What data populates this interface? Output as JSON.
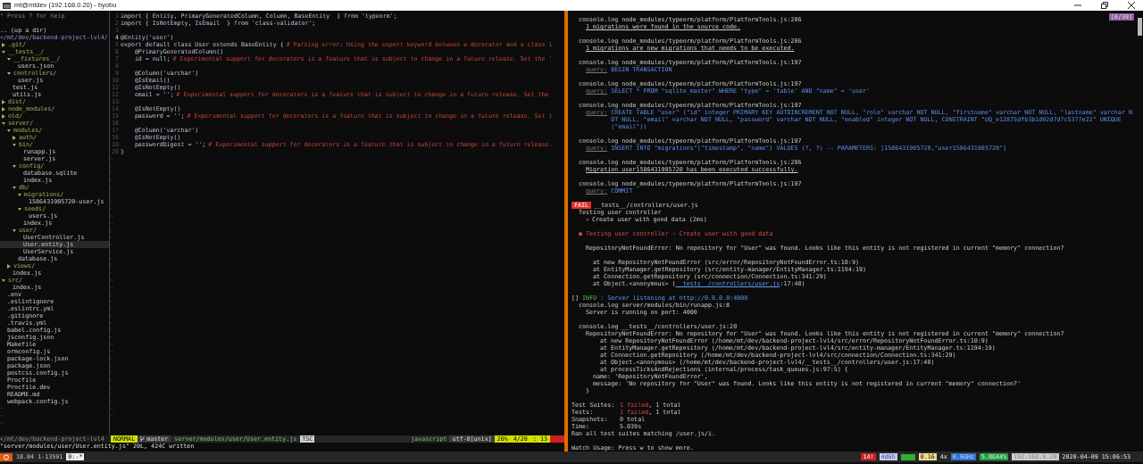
{
  "window": {
    "title": "mt@mtdev (192.168.0.20) - byobu"
  },
  "tree": {
    "help": "\" Press ? for help",
    "up": ".. (up a dir)",
    "root": "</mt/dev/backend-project-lvl4/",
    "filler": "~",
    "items": [
      {
        "name": ".git/",
        "kind": "dir",
        "expanded": false,
        "selected": false
      },
      {
        "name": "__tests__/",
        "kind": "dir",
        "expanded": true,
        "selected": false,
        "children": [
          {
            "name": "__fixtures__/",
            "kind": "dir",
            "expanded": true,
            "selected": false,
            "children": [
              {
                "name": "users.json",
                "kind": "file",
                "selected": false
              }
            ]
          },
          {
            "name": "controllers/",
            "kind": "dir",
            "expanded": true,
            "selected": false,
            "children": [
              {
                "name": "user.js",
                "kind": "file",
                "selected": false
              }
            ]
          },
          {
            "name": "test.js",
            "kind": "file",
            "selected": false
          },
          {
            "name": "utils.js",
            "kind": "file",
            "selected": false
          }
        ]
      },
      {
        "name": "dist/",
        "kind": "dir",
        "expanded": false,
        "selected": false
      },
      {
        "name": "node_modules/",
        "kind": "dir",
        "expanded": false,
        "selected": false
      },
      {
        "name": "old/",
        "kind": "dir",
        "expanded": false,
        "selected": false
      },
      {
        "name": "server/",
        "kind": "dir",
        "expanded": true,
        "selected": false,
        "children": [
          {
            "name": "modules/",
            "kind": "dir",
            "expanded": true,
            "selected": false,
            "children": [
              {
                "name": "auth/",
                "kind": "dir",
                "expanded": false,
                "selected": false
              },
              {
                "name": "bin/",
                "kind": "dir",
                "expanded": true,
                "selected": false,
                "children": [
                  {
                    "name": "runapp.js",
                    "kind": "file",
                    "selected": false
                  },
                  {
                    "name": "server.js",
                    "kind": "file",
                    "selected": false
                  }
                ]
              },
              {
                "name": "config/",
                "kind": "dir",
                "expanded": true,
                "selected": false,
                "children": [
                  {
                    "name": "database.sqlite",
                    "kind": "file",
                    "selected": false
                  },
                  {
                    "name": "index.js",
                    "kind": "file",
                    "selected": false
                  }
                ]
              },
              {
                "name": "db/",
                "kind": "dir",
                "expanded": true,
                "selected": false,
                "children": [
                  {
                    "name": "migrations/",
                    "kind": "dir",
                    "expanded": true,
                    "selected": false,
                    "children": [
                      {
                        "name": "1586431905720-user.js",
                        "kind": "file",
                        "selected": false
                      }
                    ]
                  },
                  {
                    "name": "seeds/",
                    "kind": "dir",
                    "expanded": true,
                    "selected": false,
                    "children": [
                      {
                        "name": "users.js",
                        "kind": "file",
                        "selected": false
                      }
                    ]
                  },
                  {
                    "name": "index.js",
                    "kind": "file",
                    "selected": false
                  }
                ]
              },
              {
                "name": "user/",
                "kind": "dir",
                "expanded": true,
                "selected": false,
                "children": [
                  {
                    "name": "UserController.js",
                    "kind": "file",
                    "selected": false
                  },
                  {
                    "name": "User.entity.js",
                    "kind": "file",
                    "selected": true
                  },
                  {
                    "name": "UserService.js",
                    "kind": "file",
                    "selected": false
                  }
                ]
              },
              {
                "name": "database.js",
                "kind": "file",
                "selected": false
              }
            ]
          },
          {
            "name": "views/",
            "kind": "dir",
            "expanded": false,
            "selected": false
          },
          {
            "name": "index.js",
            "kind": "file",
            "selected": false
          }
        ]
      },
      {
        "name": "src/",
        "kind": "dir",
        "expanded": true,
        "selected": false,
        "children": [
          {
            "name": "index.js",
            "kind": "file",
            "selected": false
          }
        ]
      },
      {
        "name": ".env",
        "kind": "file",
        "selected": false
      },
      {
        "name": ".eslintignore",
        "kind": "file",
        "selected": false
      },
      {
        "name": ".eslintrc.yml",
        "kind": "file",
        "selected": false
      },
      {
        "name": ".gitignore",
        "kind": "file",
        "selected": false
      },
      {
        "name": ".travis.yml",
        "kind": "file",
        "selected": false
      },
      {
        "name": "babel.config.js",
        "kind": "file",
        "selected": false
      },
      {
        "name": "jsconfig.json",
        "kind": "file",
        "selected": false
      },
      {
        "name": "Makefile",
        "kind": "file",
        "selected": false
      },
      {
        "name": "ormconfig.js",
        "kind": "file",
        "selected": false
      },
      {
        "name": "package-lock.json",
        "kind": "file",
        "selected": false
      },
      {
        "name": "package.json",
        "kind": "file",
        "selected": false
      },
      {
        "name": "postcss.config.js",
        "kind": "file",
        "selected": false
      },
      {
        "name": "Procfile",
        "kind": "file",
        "selected": false
      },
      {
        "name": "Procfile.dev",
        "kind": "file",
        "selected": false
      },
      {
        "name": "README.md",
        "kind": "file",
        "selected": false
      },
      {
        "name": "webpack.config.js",
        "kind": "file",
        "selected": false
      }
    ],
    "status": "</mt/dev/backend-project-lvl4"
  },
  "editor": {
    "filler": "~",
    "lines": [
      {
        "num": "1",
        "code": "import { Entity, PrimaryGeneratedColumn, Column, BaseEntity  } from 'typeorm';",
        "current": false
      },
      {
        "num": "2",
        "code": "import { IsNotEmpty, IsEmail  } from 'class-validator';",
        "current": false
      },
      {
        "num": "3",
        "current": false
      },
      {
        "num": "4",
        "code": "@Entity('user')",
        "current": true
      },
      {
        "num": "5",
        "code": "export default class User extends BaseEntity {",
        "comment": "# Parsing error: Using the export keyword between a decorator and a class i",
        "current": false
      },
      {
        "num": "6",
        "code": "    @PrimaryGeneratedColumn()",
        "current": false
      },
      {
        "num": "7",
        "code": "    id = null;",
        "comment": "# Experimental support for decorators is a feature that is subject to change in a future release. Set the '",
        "current": false
      },
      {
        "num": "8",
        "current": false
      },
      {
        "num": "9",
        "code": "    @Column('varchar')",
        "current": false
      },
      {
        "num": "10",
        "code": "    @IsEmail()",
        "current": false
      },
      {
        "num": "11",
        "code": "    @IsNotEmpty()",
        "current": false
      },
      {
        "num": "12",
        "code": "    email = '';",
        "comment": "# Experimental support for decorators is a feature that is subject to change in a future release. Set the",
        "current": false
      },
      {
        "num": "13",
        "current": false
      },
      {
        "num": "14",
        "code": "    @IsNotEmpty()",
        "current": false
      },
      {
        "num": "15",
        "code": "    password = '';",
        "comment": "# Experimental support for decorators is a feature that is subject to change in a future release. Set t",
        "current": false
      },
      {
        "num": "16",
        "current": false
      },
      {
        "num": "17",
        "code": "    @Column('varchar')",
        "current": false
      },
      {
        "num": "18",
        "code": "    @IsNotEmpty()",
        "current": false
      },
      {
        "num": "19",
        "code": "    passwordDigest = '';",
        "comment": "# Experimental support for decorators is a feature that is subject to change in a future release.",
        "current": false
      },
      {
        "num": "20",
        "code": "}",
        "current": false
      }
    ],
    "status": {
      "mode": "NORMAL",
      "branch": "master",
      "file": "server/modules/user/User.entity.js",
      "linter": "TSC",
      "filetype": "javascript",
      "encoding": "utf-8[unix]",
      "percent": "20%",
      "position": "4/20",
      "column": ": 13"
    },
    "command": "\"server/modules/user/User.entity.js\" 20L, 424C written"
  },
  "terminal": {
    "counter": "[0/39]",
    "lines": [
      {
        "kind": "log",
        "text": "console.log node_modules/typeorm/platform/PlatformTools.js:206"
      },
      {
        "kind": "note",
        "text": "1 migrations were found in the source code."
      },
      {
        "kind": "blank"
      },
      {
        "kind": "log",
        "text": "console.log node_modules/typeorm/platform/PlatformTools.js:206"
      },
      {
        "kind": "note",
        "text": "1 migrations are new migrations that needs to be executed."
      },
      {
        "kind": "blank"
      },
      {
        "kind": "log",
        "text": "console.log node_modules/typeorm/platform/PlatformTools.js:197"
      },
      {
        "kind": "query",
        "label": "query:",
        "text": "BEGIN TRANSACTION"
      },
      {
        "kind": "blank"
      },
      {
        "kind": "log",
        "text": "console.log node_modules/typeorm/platform/PlatformTools.js:197"
      },
      {
        "kind": "query",
        "label": "query:",
        "text": "SELECT * FROM \"sqlite_master\" WHERE \"type\" = 'table' AND \"name\" = 'user'"
      },
      {
        "kind": "blank"
      },
      {
        "kind": "log",
        "text": "console.log node_modules/typeorm/platform/PlatformTools.js:197"
      },
      {
        "kind": "query",
        "label": "query:",
        "text": "CREATE TABLE \"user\" (\"id\" integer PRIMARY KEY AUTOINCREMENT NOT NULL, \"role\" varchar NOT NULL, \"firstname\" varchar NOT NULL, \"lastname\" varchar NOT NULL, \"email\" varchar NOT NULL, \"password\" varchar NOT NULL, \"enabled\" integer NOT NULL, CONSTRAINT \"UQ_e12875dfb3b1d92d7d7c5377e22\" UNIQUE (\"email\"))"
      },
      {
        "kind": "blank"
      },
      {
        "kind": "log",
        "text": "console.log node_modules/typeorm/platform/PlatformTools.js:197"
      },
      {
        "kind": "query",
        "label": "query:",
        "text": "INSERT INTO \"migrations\"(\"timestamp\", \"name\") VALUES (?, ?) -- PARAMETERS: [1586431905720,\"user1586431905720\"]"
      },
      {
        "kind": "blank"
      },
      {
        "kind": "log",
        "text": "console.log node_modules/typeorm/platform/PlatformTools.js:206"
      },
      {
        "kind": "note",
        "text": "Migration user1586431905720 has been executed successfully."
      },
      {
        "kind": "blank"
      },
      {
        "kind": "log",
        "text": "console.log node_modules/typeorm/platform/PlatformTools.js:197"
      },
      {
        "kind": "query",
        "label": "query:",
        "text": "COMMIT"
      },
      {
        "kind": "blank"
      },
      {
        "kind": "fail",
        "label": "FAIL",
        "text": "__tests__/controllers/user.js"
      },
      {
        "kind": "suite",
        "text": "Testing user controller"
      },
      {
        "kind": "test",
        "mark": "✕",
        "text": "Create user with good data (2ms)"
      },
      {
        "kind": "blank"
      },
      {
        "kind": "error-title",
        "text": "● Testing user controller › Create user with good data"
      },
      {
        "kind": "blank"
      },
      {
        "kind": "error",
        "text": "RepositoryNotFoundError: No repository for \"User\" was found. Looks like this entity is not registered in current \"memory\" connection?"
      },
      {
        "kind": "blank"
      },
      {
        "kind": "stack",
        "text": "at new RepositoryNotFoundError (src/error/RepositoryNotFoundError.ts:10:9)"
      },
      {
        "kind": "stack",
        "text": "at EntityManager.getRepository (src/entity-manager/EntityManager.ts:1194:19)"
      },
      {
        "kind": "stack",
        "text": "at Connection.getRepository (src/connection/Connection.ts:341:29)"
      },
      {
        "kind": "stack",
        "text": "at Object.<anonymous> (",
        "link": "__tests__/controllers/user.js",
        "tail": ":17:40)"
      },
      {
        "kind": "blank"
      },
      {
        "kind": "info",
        "prefix": "[]",
        "level": "INFO",
        "text": ": Server listening at http://0.0.0.0:4000"
      },
      {
        "kind": "log",
        "text": "console.log server/modules/bin/runapp.js:8"
      },
      {
        "kind": "detail",
        "text": "Server is running on port: 4000"
      },
      {
        "kind": "blank"
      },
      {
        "kind": "log",
        "text": "console.log __tests__/controllers/user.js:20"
      },
      {
        "kind": "detail",
        "text": "RepositoryNotFoundError: No repository for \"User\" was found. Looks like this entity is not registered in current \"memory\" connection?"
      },
      {
        "kind": "deep",
        "text": "at new RepositoryNotFoundError (/home/mt/dev/backend-project-lvl4/src/error/RepositoryNotFoundError.ts:10:9)"
      },
      {
        "kind": "deep",
        "text": "at EntityManager.getRepository (/home/mt/dev/backend-project-lvl4/src/entity-manager/EntityManager.ts:1194:19)"
      },
      {
        "kind": "deep",
        "text": "at Connection.getRepository (/home/mt/dev/backend-project-lvl4/src/connection/Connection.ts:341:29)"
      },
      {
        "kind": "deep",
        "text": "at Object.<anonymous> (/home/mt/dev/backend-project-lvl4/__tests__/controllers/user.js:17:40)"
      },
      {
        "kind": "deep",
        "text": "at processTicksAndRejections (internal/process/task_queues.js:97:5) {"
      },
      {
        "kind": "field",
        "text": "name: 'RepositoryNotFoundError',"
      },
      {
        "kind": "field",
        "text": "message: 'No repository for \"User\" was found. Looks like this entity is not registered in current \"memory\" connection?'"
      },
      {
        "kind": "detail",
        "text": "}"
      },
      {
        "kind": "blank"
      },
      {
        "kind": "summary",
        "label": "Test Suites:",
        "failed": "1 failed",
        "text": ", 1 total"
      },
      {
        "kind": "summary",
        "label": "Tests:",
        "failed": "1 failed",
        "text": ", 1 total"
      },
      {
        "kind": "summary",
        "label": "Snapshots:",
        "text": "0 total"
      },
      {
        "kind": "summary",
        "label": "Time:",
        "text": "5.039s"
      },
      {
        "kind": "plain",
        "text": "Ran all test suites matching /user.js/i."
      },
      {
        "kind": "blank"
      },
      {
        "kind": "plain",
        "text": "Watch Usage: Press w to show more."
      }
    ]
  },
  "byobu": {
    "release": "18.04",
    "session": "1-13591",
    "window": "0:-*",
    "stats": [
      {
        "kind": "alert",
        "text": "14!"
      },
      {
        "kind": "uptime",
        "text": "4d6h"
      },
      {
        "kind": "meter"
      },
      {
        "kind": "load",
        "text": "0.16"
      },
      {
        "kind": "plain",
        "text": "4x"
      },
      {
        "kind": "cpu",
        "text": "0.9GHz"
      },
      {
        "kind": "mem",
        "text": "5.8G44%"
      },
      {
        "kind": "ip",
        "text": "192.168.0.20"
      },
      {
        "kind": "plain",
        "text": "2020-04-09 15:06:53"
      }
    ]
  }
}
